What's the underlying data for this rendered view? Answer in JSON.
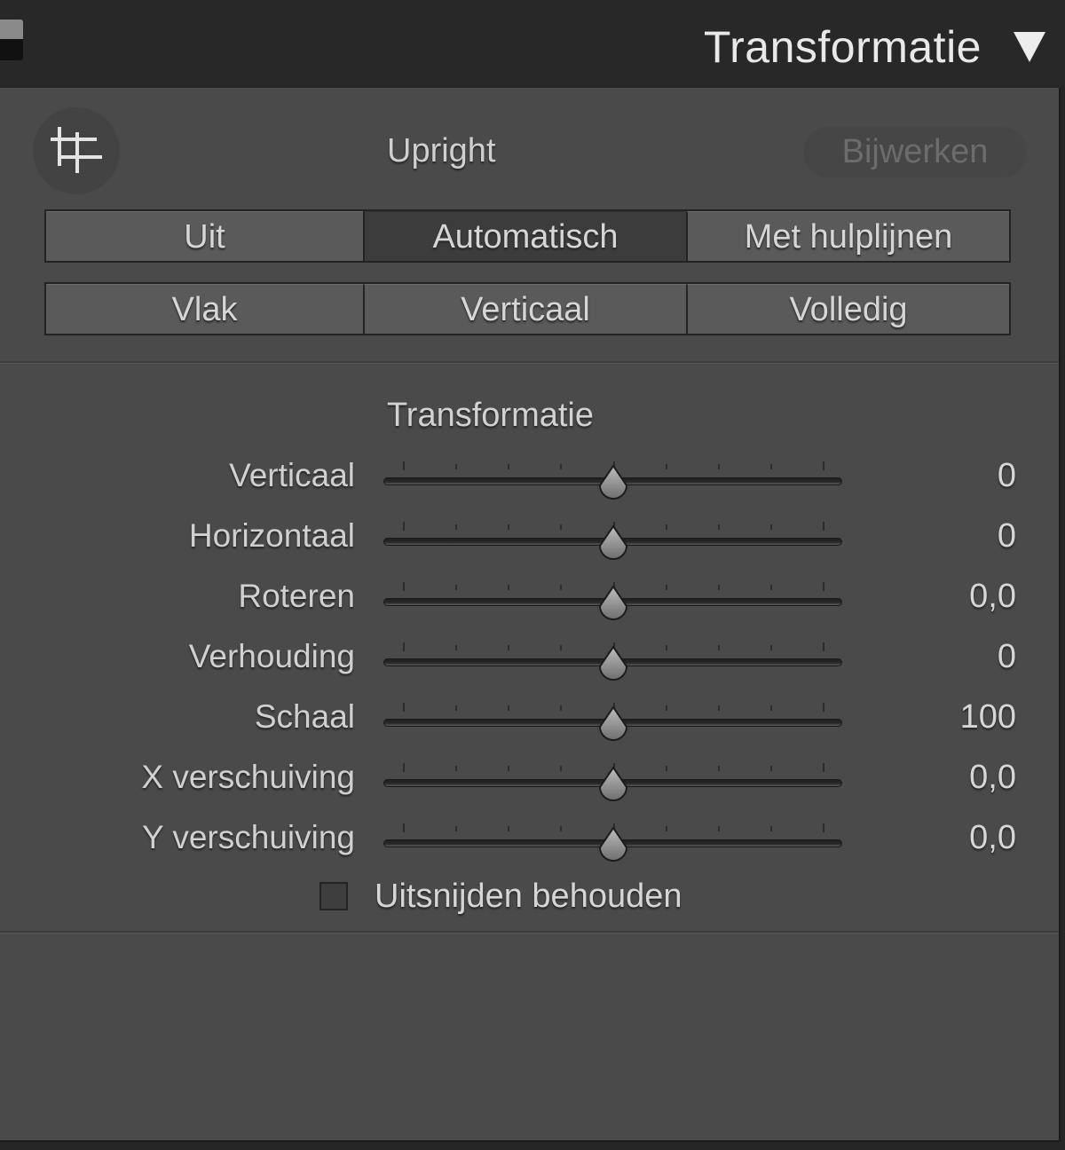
{
  "header": {
    "title": "Transformatie",
    "caret_icon": "triangle-down-icon"
  },
  "upright": {
    "tool_icon": "crop-grid-icon",
    "label": "Upright",
    "update_button": "Bijwerken",
    "modes_row1": [
      {
        "label": "Uit",
        "active": false
      },
      {
        "label": "Automatisch",
        "active": true
      },
      {
        "label": "Met hulplijnen",
        "active": false
      }
    ],
    "modes_row2": [
      {
        "label": "Vlak",
        "active": false
      },
      {
        "label": "Verticaal",
        "active": false
      },
      {
        "label": "Volledig",
        "active": false
      }
    ]
  },
  "transform": {
    "title": "Transformatie",
    "sliders": [
      {
        "label": "Verticaal",
        "value": "0",
        "position": 0.5
      },
      {
        "label": "Horizontaal",
        "value": "0",
        "position": 0.5
      },
      {
        "label": "Roteren",
        "value": "0,0",
        "position": 0.5
      },
      {
        "label": "Verhouding",
        "value": "0",
        "position": 0.5
      },
      {
        "label": "Schaal",
        "value": "100",
        "position": 0.5
      },
      {
        "label": "X verschuiving",
        "value": "0,0",
        "position": 0.5
      },
      {
        "label": "Y verschuiving",
        "value": "0,0",
        "position": 0.5
      }
    ],
    "constrain_crop": {
      "label": "Uitsnijden behouden",
      "checked": false
    }
  },
  "colors": {
    "panel_bg": "#4a4a4a",
    "header_bg": "#282828",
    "text": "#d6d6d6",
    "active_segment": "#3c3c3c"
  }
}
